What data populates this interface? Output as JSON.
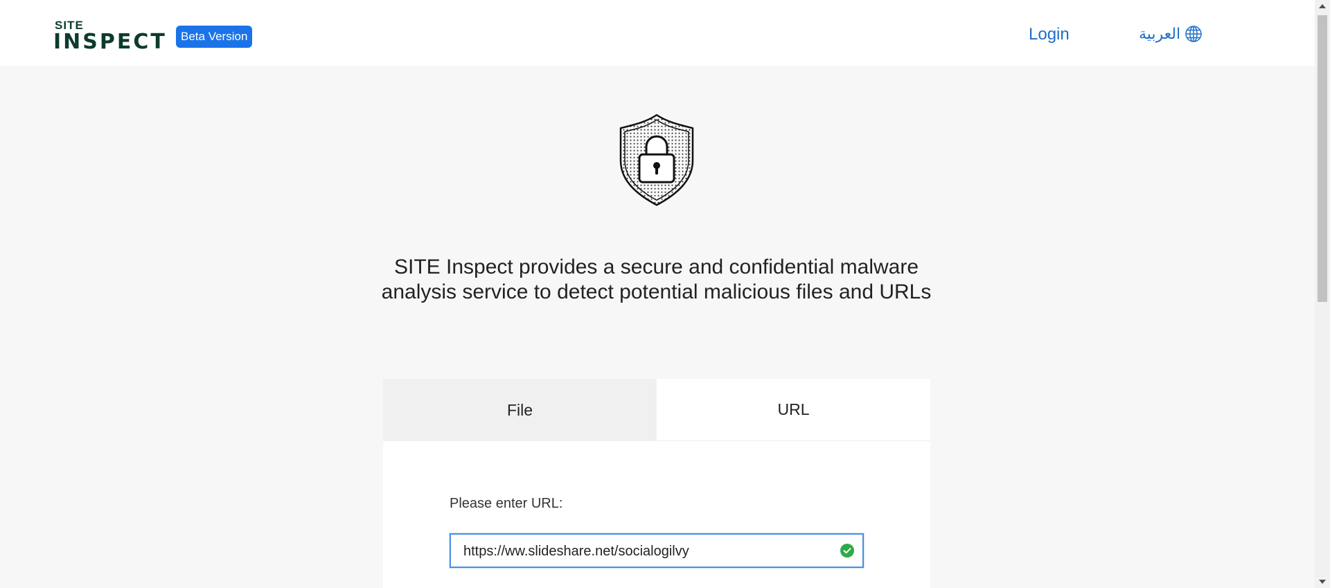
{
  "header": {
    "logo_top": "SITE",
    "logo_bottom": "INSPECT",
    "badge": "Beta Version",
    "login": "Login",
    "language": "العربية",
    "language_icon": "globe-icon"
  },
  "hero": {
    "icon": "shield-lock-icon",
    "headline": "SITE Inspect provides a secure and confidential malware analysis service to detect potential malicious files and URLs"
  },
  "tabs": [
    {
      "label": "File",
      "active": false
    },
    {
      "label": "URL",
      "active": true
    }
  ],
  "form": {
    "label": "Please enter URL:",
    "value": "https://ww.slideshare.net/socialogilvy",
    "valid_icon": "check-circle-icon"
  },
  "colors": {
    "brand": "#0d3b2e",
    "badge": "#1a73e8",
    "link": "#1f6fc5",
    "valid": "#2eaa4a"
  }
}
